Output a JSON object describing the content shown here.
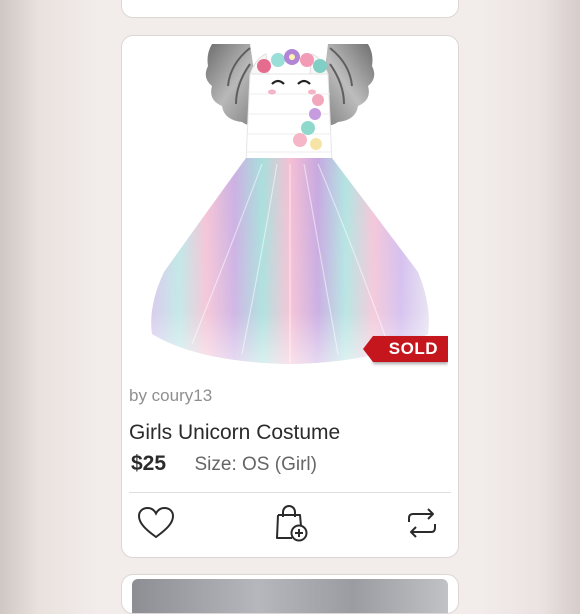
{
  "listing": {
    "seller": "by coury13",
    "title": "Girls Unicorn Costume",
    "price": "$25",
    "size": "Size: OS (Girl)",
    "badge": "SOLD",
    "image_alt": "Girls unicorn tutu dress with silver wings, flower headband and pastel tulle skirt"
  },
  "actions": {
    "like": "heart-icon",
    "bundle": "shopping-bag-add-icon",
    "share": "share-repost-icon"
  },
  "colors": {
    "sold_badge": "#c4161c",
    "card_background": "#ffffff",
    "page_background": "#f2eceb"
  }
}
